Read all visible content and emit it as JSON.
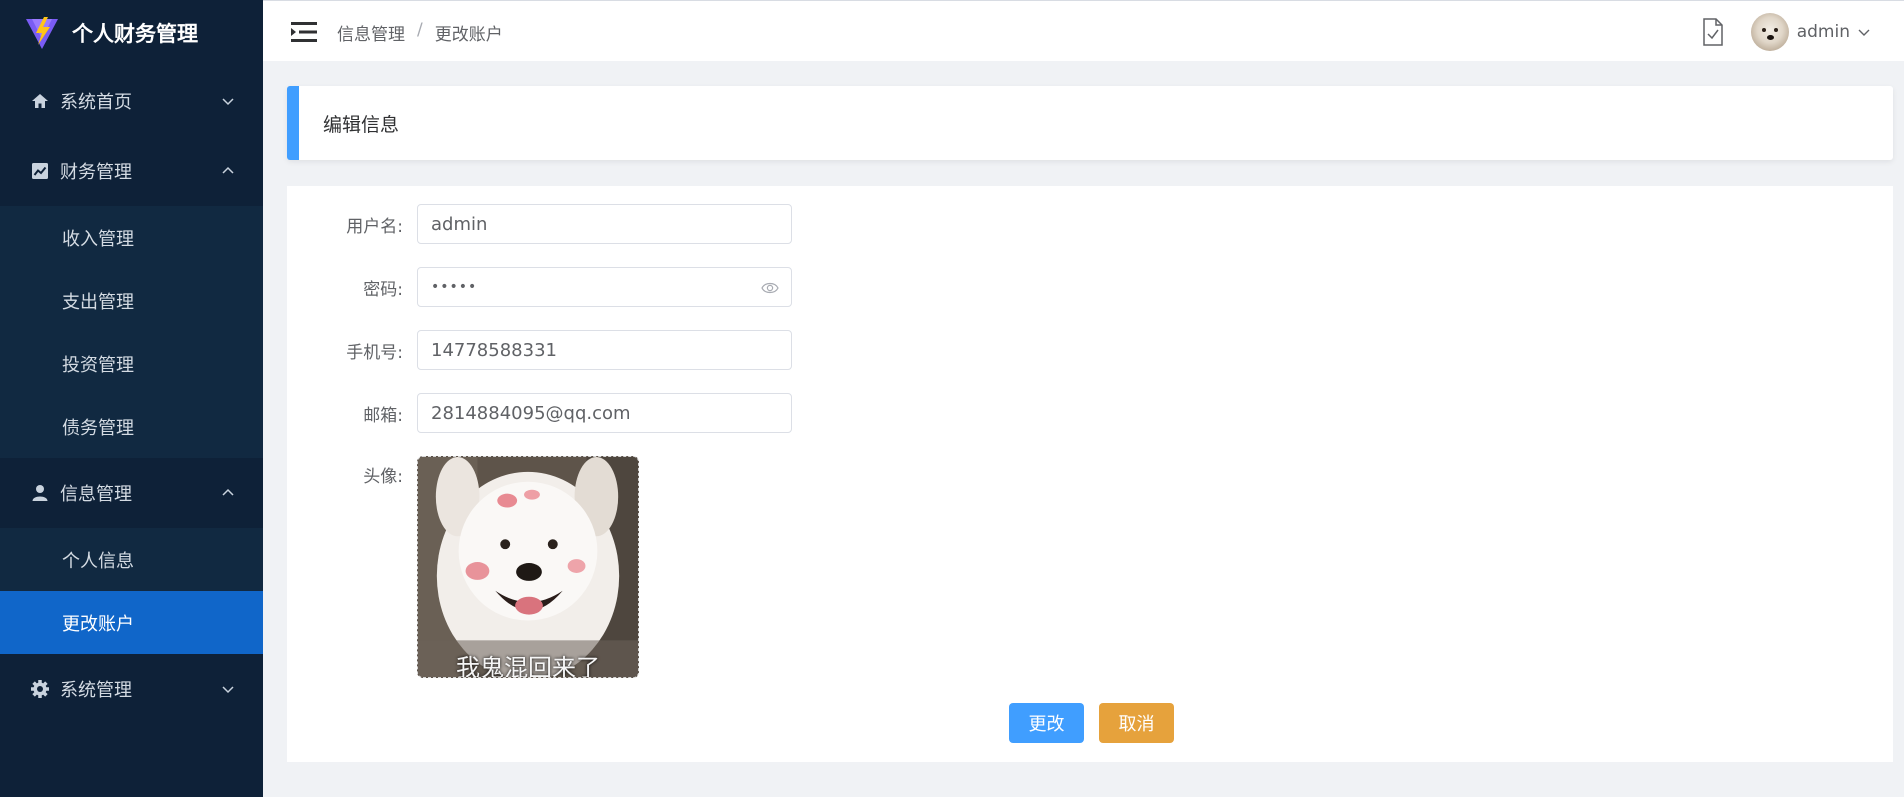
{
  "app": {
    "title": "个人财务管理"
  },
  "sidebar": {
    "menus": [
      {
        "label": "系统首页",
        "icon": "home-icon",
        "expanded": false,
        "items": []
      },
      {
        "label": "财务管理",
        "icon": "chart-icon",
        "expanded": true,
        "items": [
          "收入管理",
          "支出管理",
          "投资管理",
          "债务管理"
        ]
      },
      {
        "label": "信息管理",
        "icon": "user-icon",
        "expanded": true,
        "items": [
          "个人信息",
          "更改账户"
        ]
      },
      {
        "label": "系统管理",
        "icon": "gear-icon",
        "expanded": false,
        "items": []
      }
    ],
    "active_item": "更改账户"
  },
  "header": {
    "breadcrumb": [
      "信息管理",
      "更改账户"
    ],
    "breadcrumb_sep": "/",
    "user": "admin"
  },
  "page": {
    "title": "编辑信息"
  },
  "form": {
    "username_label": "用户名:",
    "username": "admin",
    "password_label": "密码:",
    "password_masked": "•••••",
    "phone_label": "手机号:",
    "phone": "14778588331",
    "email_label": "邮箱:",
    "email": "2814884095@qq.com",
    "avatar_label": "头像:",
    "avatar_caption": "我鬼混回来了"
  },
  "buttons": {
    "submit": "更改",
    "cancel": "取消"
  },
  "colors": {
    "sidebar": "#0e2138",
    "active": "#1066c9",
    "primary": "#409eff",
    "warning": "#e6a23c"
  }
}
